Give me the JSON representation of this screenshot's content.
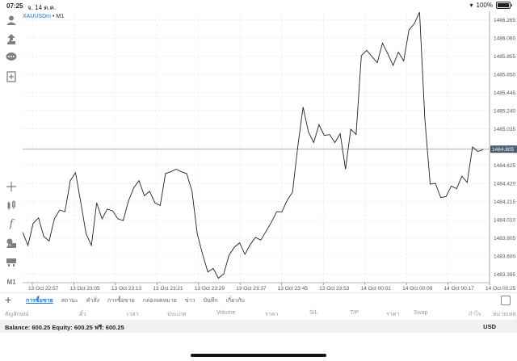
{
  "status": {
    "time": "07:25",
    "date": "จ. 14 ต.ค.",
    "battery": "100%"
  },
  "symbol": {
    "name": "XAUUSDm",
    "separator": "•",
    "timeframe": "M1"
  },
  "current_price": "1484.805",
  "tabs": [
    "การซื้อขาย",
    "สถานะ",
    "คำสั่ง",
    "การซื้อขาย",
    "กล่องจดหมาย",
    "ข่าว",
    "บันทึก",
    "เกี่ยวกับ"
  ],
  "table_headers": [
    "สัญลักษณ์",
    "ตั๋ว",
    "เวลา",
    "ประเภท",
    "Volume",
    "ราคา",
    "S/L",
    "T/P",
    "ราคา",
    "Swap",
    "กำไร",
    "หมายเหตุ"
  ],
  "balance": "Balance: 600.25  Equity: 600.25  ฟรี: 600.25",
  "currency": "USD",
  "colors": {
    "accent": "#1a73e8",
    "price_box": "#4a5d73",
    "line": "#222222"
  },
  "toolbar_icons": [
    "person-icon",
    "arrows-icon",
    "chat-bubble-icon",
    "add-document-icon",
    "crosshair-icon",
    "candles-icon",
    "function-icon",
    "objects-icon",
    "trade-icon",
    "m1-icon"
  ],
  "toolbar_m1_label": "M1",
  "chart_data": {
    "type": "line",
    "x_tick_labels": [
      "13 Oct 22:57",
      "13 Oct 23:05",
      "13 Oct 23:13",
      "13 Oct 23:21",
      "13 Oct 23:29",
      "13 Oct 23:37",
      "13 Oct 23:45",
      "13 Oct 23:53",
      "14 Oct 00:01",
      "14 Oct 00:09",
      "14 Oct 00:17",
      "14 Oct 00:25"
    ],
    "y_tick_labels": [
      "1486.265",
      "1486.060",
      "1485.855",
      "1485.650",
      "1485.445",
      "1485.240",
      "1485.035",
      "1484.830",
      "1484.625",
      "1484.420",
      "1484.215",
      "1484.010",
      "1483.805",
      "1483.600",
      "1483.395"
    ],
    "ylim": [
      1483.3,
      1486.36
    ],
    "price_line": 1484.805,
    "values": [
      1483.87,
      1483.72,
      1483.97,
      1484.03,
      1483.82,
      1483.77,
      1484.02,
      1484.12,
      1484.1,
      1484.45,
      1484.54,
      1484.2,
      1483.85,
      1483.72,
      1484.2,
      1484.02,
      1484.13,
      1484.11,
      1484.02,
      1484.0,
      1484.22,
      1484.37,
      1484.45,
      1484.28,
      1484.33,
      1484.2,
      1484.17,
      1484.53,
      1484.55,
      1484.58,
      1484.55,
      1484.53,
      1484.33,
      1483.85,
      1483.62,
      1483.42,
      1483.46,
      1483.35,
      1483.4,
      1483.61,
      1483.7,
      1483.75,
      1483.62,
      1483.73,
      1483.81,
      1483.78,
      1483.88,
      1483.98,
      1484.1,
      1484.1,
      1484.23,
      1484.32,
      1484.84,
      1485.28,
      1485.0,
      1484.88,
      1485.08,
      1484.96,
      1484.97,
      1484.88,
      1484.98,
      1484.58,
      1485.03,
      1484.97,
      1485.86,
      1485.92,
      1485.85,
      1485.78,
      1486.0,
      1485.88,
      1485.75,
      1485.9,
      1485.8,
      1486.15,
      1486.22,
      1486.35,
      1485.15,
      1484.41,
      1484.42,
      1484.26,
      1484.27,
      1484.39,
      1484.36,
      1484.5,
      1484.43,
      1484.83,
      1484.78,
      1484.8
    ]
  }
}
